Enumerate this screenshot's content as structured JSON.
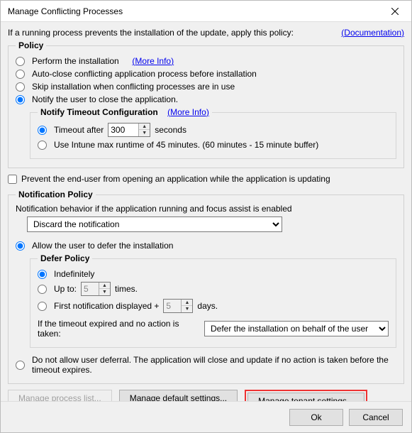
{
  "window": {
    "title": "Manage Conflicting Processes"
  },
  "top": {
    "intro": "If a running process prevents the installation of the update, apply this policy:",
    "doc_link": "Documentation"
  },
  "policy": {
    "legend": "Policy",
    "perform": "Perform the installation",
    "perform_more": "More Info",
    "autoclose": "Auto-close conflicting application process before installation",
    "skip": "Skip installation when conflicting processes are in use",
    "notify": "Notify the user to close the application.",
    "notify_timeout": {
      "legend": "Notify Timeout Configuration",
      "more": "More Info",
      "timeout_after": "Timeout after",
      "timeout_value": "300",
      "timeout_unit": "seconds",
      "intune": "Use Intune max runtime of 45 minutes. (60 minutes - 15 minute buffer)"
    }
  },
  "prevent_checkbox": "Prevent the end-user from opening an application while the application is updating",
  "notification": {
    "legend": "Notification Policy",
    "behavior_label": "Notification behavior if the application running and focus assist is enabled",
    "behavior_value": "Discard the notification",
    "allow_defer": "Allow the user to defer the installation",
    "defer": {
      "legend": "Defer Policy",
      "indef": "Indefinitely",
      "upto": "Up to:",
      "upto_value": "5",
      "upto_unit": "times.",
      "first": "First notification displayed +",
      "first_value": "5",
      "first_unit": "days.",
      "fallback_label": "If the timeout expired and no action is taken:",
      "fallback_value": "Defer the installation on behalf of the user"
    },
    "no_defer": "Do not allow user deferral. The application will close and update if no action is taken before the timeout expires."
  },
  "buttons": {
    "manage_list": "Manage process list...",
    "manage_default": "Manage default settings...",
    "manage_tenant": "Manage tenant settings...",
    "ok": "Ok",
    "cancel": "Cancel"
  }
}
